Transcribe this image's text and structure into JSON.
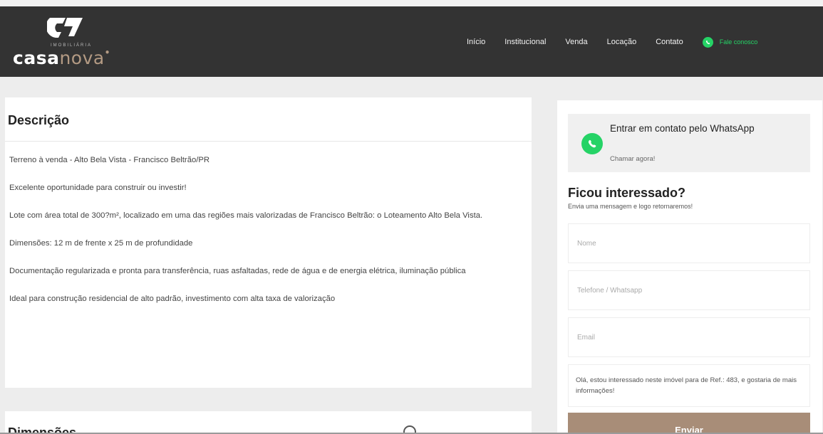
{
  "header": {
    "logo": {
      "tagline": "IMOBILIÁRIA",
      "word_light": "casa",
      "word_accent": "nova"
    },
    "nav": [
      {
        "label": "Início"
      },
      {
        "label": "Institucional"
      },
      {
        "label": "Venda"
      },
      {
        "label": "Locação"
      },
      {
        "label": "Contato"
      }
    ],
    "whatsapp_link": "Fale conosco",
    "colors": {
      "background": "#333333",
      "accent": "#b39a83",
      "whatsapp": "#25d366"
    }
  },
  "description": {
    "title": "Descrição",
    "paragraphs": [
      "Terreno à venda - Alto Bela Vista - Francisco Beltrão/PR",
      "Excelente oportunidade para construir ou investir!",
      "Lote com área total de 300?m², localizado em uma das regiões mais valorizadas de Francisco Beltrão: o Loteamento Alto Bela Vista.",
      "Dimensões: 12 m de frente x 25 m de profundidade",
      "Documentação regularizada e pronta para transferência, ruas asfaltadas, rede de água e de energia elétrica, iluminação pública",
      "Ideal para construção residencial de alto padrão, investimento com alta taxa de valorização"
    ]
  },
  "dimensions": {
    "title": "Dimensões"
  },
  "sidebar": {
    "whatsapp": {
      "title": "Entrar em contato pelo WhatsApp",
      "subtitle": "Chamar agora!",
      "icon": "whatsapp-icon"
    },
    "form": {
      "title": "Ficou interessado?",
      "subtitle": "Envia uma mensagem e logo retornaremos!",
      "name_placeholder": "Nome",
      "phone_placeholder": "Telefone / Whatsapp",
      "email_placeholder": "Email",
      "message_value": "Olá, estou interessado neste imóvel para de Ref.: 483, e gostaria de mais informações!",
      "submit_label": "Enviar",
      "button_color": "#a88d78"
    }
  }
}
